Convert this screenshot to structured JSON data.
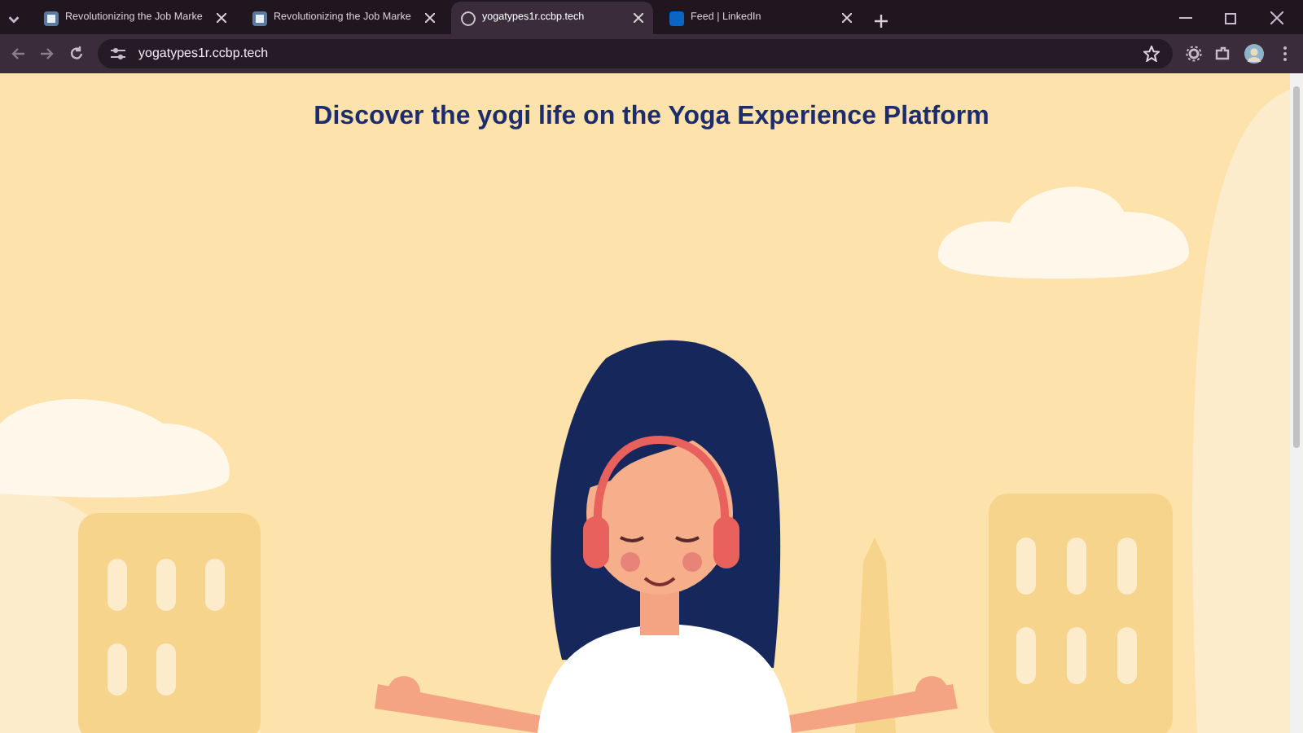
{
  "browser": {
    "tabs": [
      {
        "title": "Revolutionizing the Job Marke",
        "kind": "document",
        "selected": false
      },
      {
        "title": "Revolutionizing the Job Marke",
        "kind": "document",
        "selected": false
      },
      {
        "title": "yogatypes1r.ccbp.tech",
        "kind": "globe",
        "selected": true
      },
      {
        "title": "Feed | LinkedIn",
        "kind": "linkedin",
        "selected": false
      }
    ],
    "address": "yogatypes1r.ccbp.tech"
  },
  "page": {
    "heading": "Discover the yogi life on the Yoga Experience Platform"
  }
}
